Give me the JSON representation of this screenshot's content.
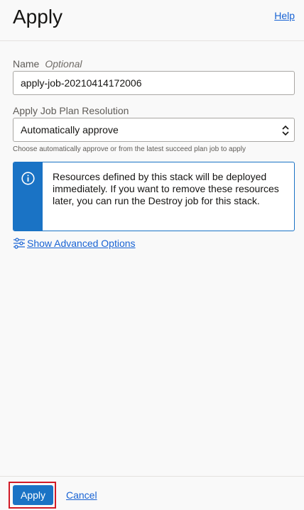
{
  "header": {
    "title": "Apply",
    "help_label": "Help"
  },
  "form": {
    "name_label": "Name",
    "name_optional": "Optional",
    "name_value": "apply-job-20210414172006",
    "plan_label": "Apply Job Plan Resolution",
    "plan_value": "Automatically approve",
    "plan_hint": "Choose automatically approve or from the latest succeed plan job to apply"
  },
  "info": {
    "icon": "info-icon",
    "text": "Resources defined by this stack will be deployed immediately. If you want to remove these resources later, you can run the Destroy job for this stack."
  },
  "advanced": {
    "icon": "sliders-icon",
    "label": "Show Advanced Options"
  },
  "footer": {
    "apply_label": "Apply",
    "cancel_label": "Cancel"
  },
  "colors": {
    "accent": "#1a73c5",
    "link": "#1863d4",
    "highlight": "#d11a26"
  }
}
